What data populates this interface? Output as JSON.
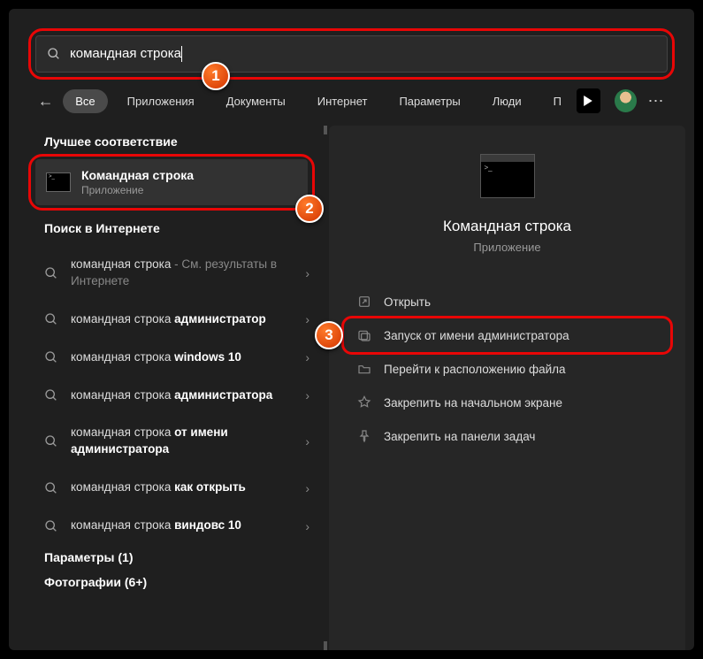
{
  "search": {
    "value": "командная строка"
  },
  "tabs": [
    "Все",
    "Приложения",
    "Документы",
    "Интернет",
    "Параметры",
    "Люди",
    "П"
  ],
  "left": {
    "best_match_header": "Лучшее соответствие",
    "best_match": {
      "title": "Командная строка",
      "subtitle": "Приложение"
    },
    "web_header": "Поиск в Интернете",
    "items": [
      {
        "pre": "командная строка",
        "dim": " - См. результаты в Интернете",
        "bold": ""
      },
      {
        "pre": "командная строка ",
        "dim": "",
        "bold": "администратор"
      },
      {
        "pre": "командная строка ",
        "dim": "",
        "bold": "windows 10"
      },
      {
        "pre": "командная строка ",
        "dim": "",
        "bold": "администратора"
      },
      {
        "pre": "командная строка ",
        "dim": "",
        "bold": "от имени администратора"
      },
      {
        "pre": "командная строка ",
        "dim": "",
        "bold": "как открыть"
      },
      {
        "pre": "командная строка ",
        "dim": "",
        "bold": "виндовс 10"
      }
    ],
    "params_header": "Параметры (1)",
    "photos_header": "Фотографии (6+)"
  },
  "preview": {
    "title": "Командная строка",
    "subtitle": "Приложение",
    "actions": [
      "Открыть",
      "Запуск от имени администратора",
      "Перейти к расположению файла",
      "Закрепить на начальном экране",
      "Закрепить на панели задач"
    ]
  },
  "badges": {
    "b1": "1",
    "b2": "2",
    "b3": "3"
  }
}
